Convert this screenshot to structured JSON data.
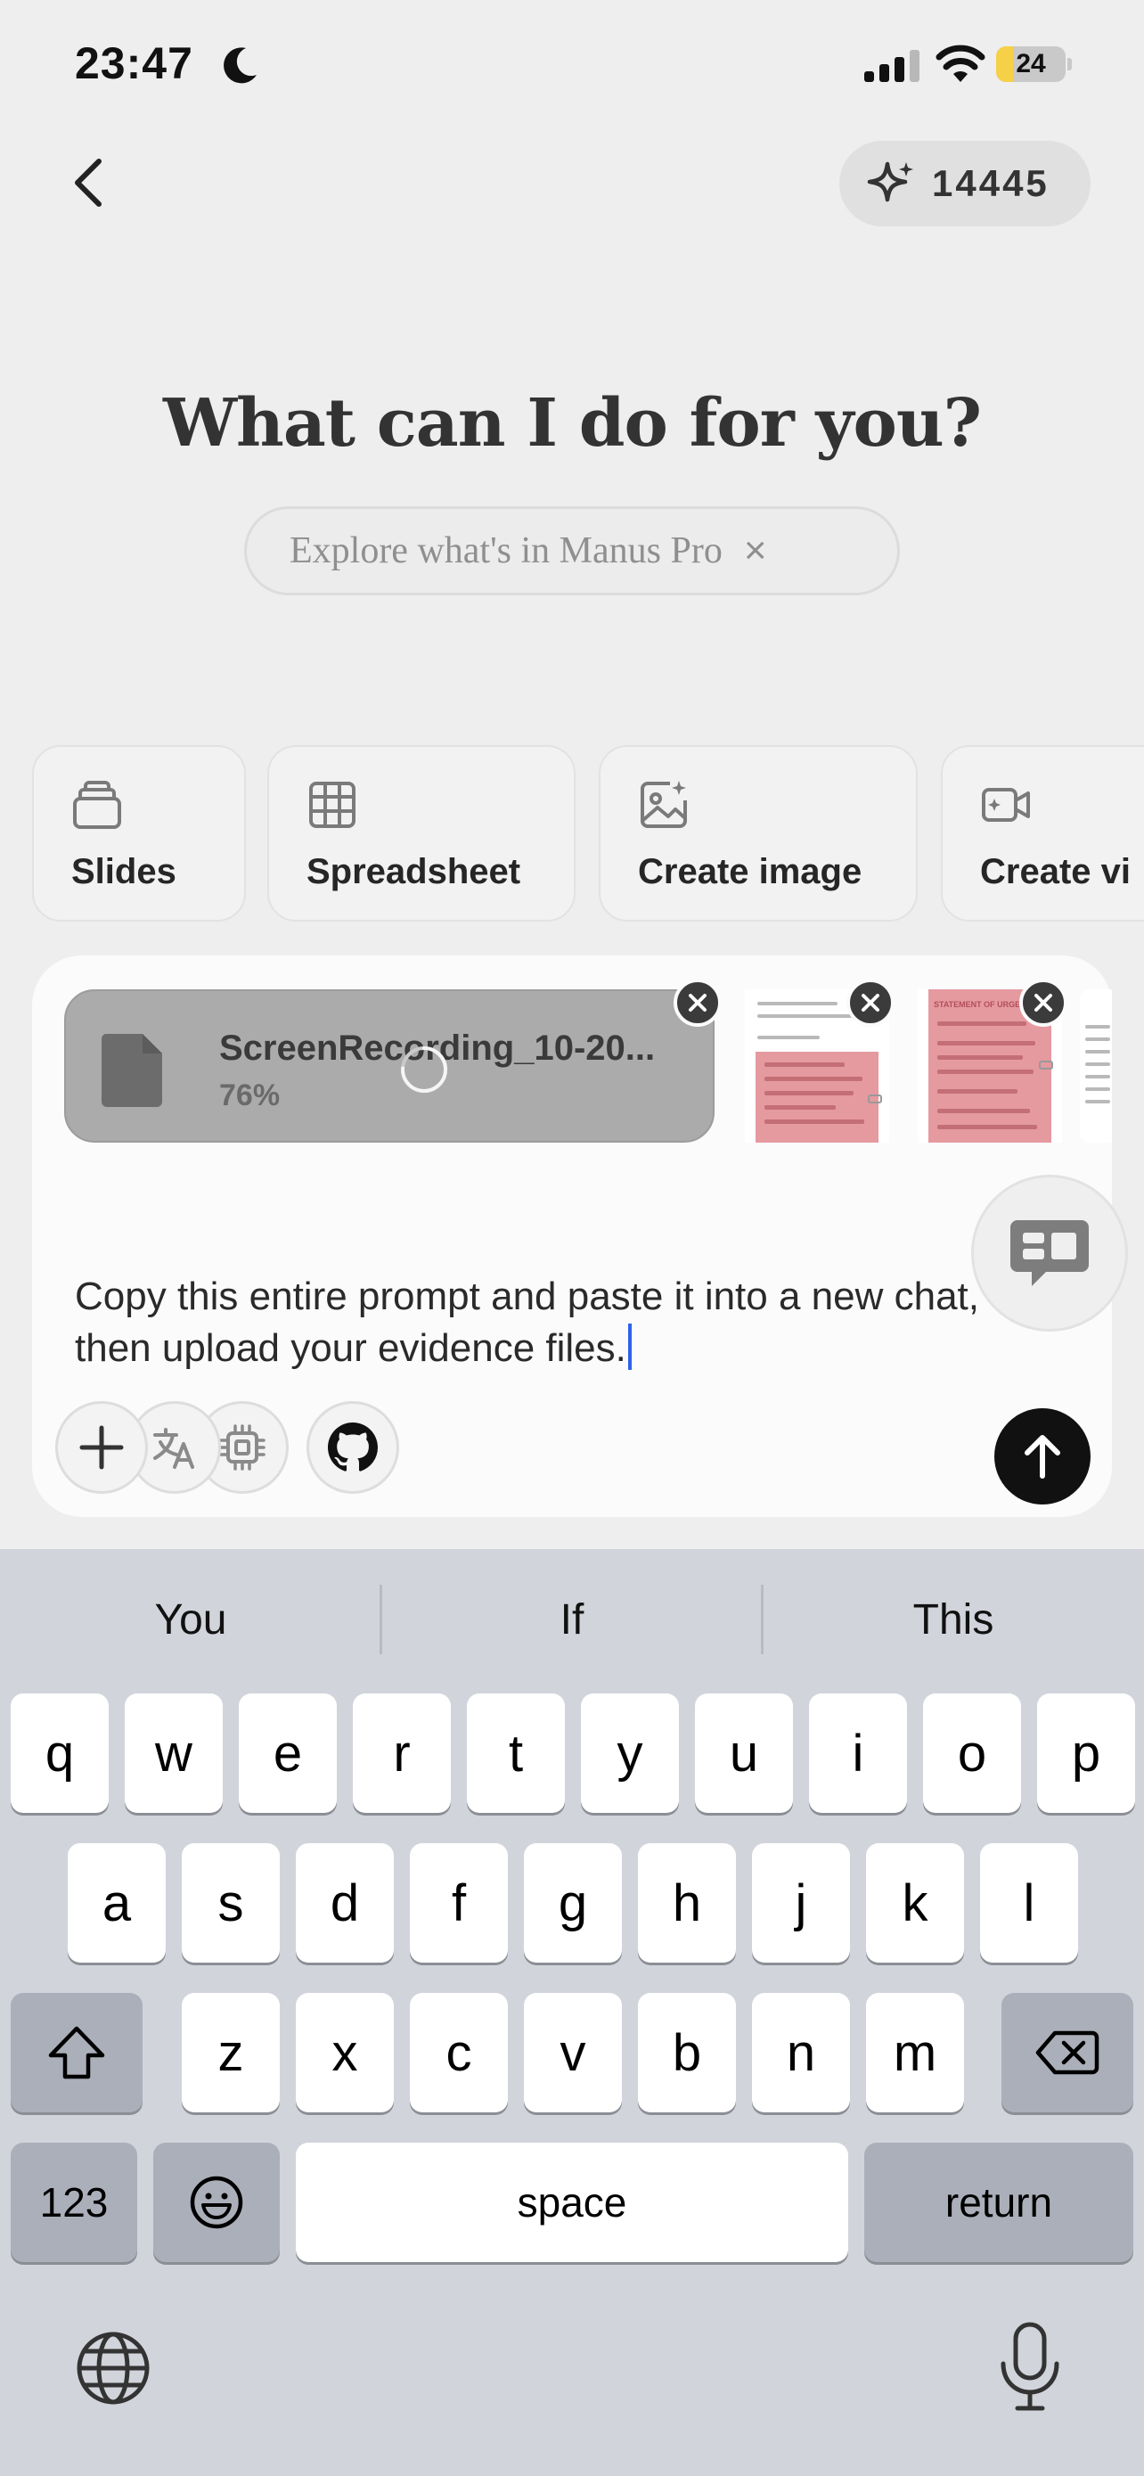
{
  "status_bar": {
    "time": "23:47",
    "battery": "24",
    "battery_level": 0.24
  },
  "header": {
    "credits": "14445"
  },
  "hero": {
    "title": "What can I do for you?",
    "promo": "Explore what's in Manus Pro",
    "promo_close": "×"
  },
  "tools": [
    {
      "label": "Slides",
      "icon": "stack-icon"
    },
    {
      "label": "Spreadsheet",
      "icon": "table-icon"
    },
    {
      "label": "Create image",
      "icon": "image-sparkle-icon"
    },
    {
      "label": "Create vi",
      "icon": "video-icon"
    }
  ],
  "composer": {
    "attachment": {
      "file_name": "ScreenRecording_10-20...",
      "progress": "76%",
      "progress_value": 0.76
    },
    "thumb1_heading": "STATEMENT OF URGENCY",
    "prompt": "Copy this entire prompt and paste it into a new chat, then upload your evidence files."
  },
  "keyboard": {
    "suggestions": [
      "You",
      "If",
      "This"
    ],
    "row1": [
      "q",
      "w",
      "e",
      "r",
      "t",
      "y",
      "u",
      "i",
      "o",
      "p"
    ],
    "row2": [
      "a",
      "s",
      "d",
      "f",
      "g",
      "h",
      "j",
      "k",
      "l"
    ],
    "row3": [
      "z",
      "x",
      "c",
      "v",
      "b",
      "n",
      "m"
    ],
    "numbers_label": "123",
    "space_label": "space",
    "return_label": "return"
  }
}
